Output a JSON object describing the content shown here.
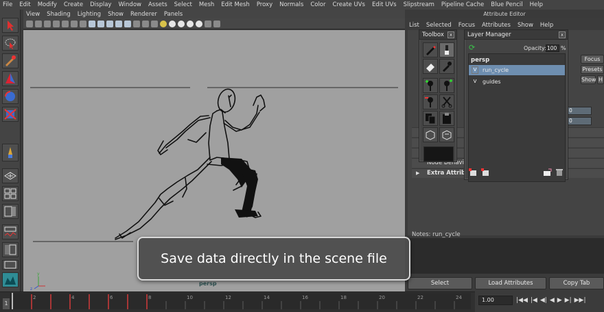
{
  "menubar": [
    "File",
    "Edit",
    "Modify",
    "Create",
    "Display",
    "Window",
    "Assets",
    "Select",
    "Mesh",
    "Edit Mesh",
    "Proxy",
    "Normals",
    "Color",
    "Create UVs",
    "Edit UVs",
    "Slipstream",
    "Pipeline Cache",
    "Blue Pencil",
    "Help"
  ],
  "viewport": {
    "menu": [
      "View",
      "Shading",
      "Lighting",
      "Show",
      "Renderer",
      "Panels"
    ],
    "camera": "persp"
  },
  "attribute_editor": {
    "title": "Attribute Editor",
    "menu": [
      "List",
      "Selected",
      "Focus",
      "Attributes",
      "Show",
      "Help"
    ],
    "focus_button": "Focus",
    "presets_button": "Presets",
    "show_button": "Show",
    "hide_button": "H",
    "field_1": "0",
    "field_2": "0",
    "section_node_behavior": "Node Behavior",
    "section_extra": "Extra Attributes",
    "notes_label": "Notes: run_cycle",
    "select_button": "Select",
    "load_button": "Load Attributes",
    "copy_button": "Copy Tab"
  },
  "toolbox": {
    "title": "Toolbox",
    "close": "x"
  },
  "layer_manager": {
    "title": "Layer Manager",
    "close": "x",
    "opacity_label": "Opacity:",
    "opacity_value": "100",
    "opacity_unit": "%",
    "header": "persp",
    "layers": [
      {
        "v": "V",
        "name": "run_cycle",
        "selected": true
      },
      {
        "v": "V",
        "name": "guides",
        "selected": false
      }
    ]
  },
  "timeline": {
    "start_frame": "1",
    "ticks": [
      "2",
      "4",
      "6",
      "8",
      "10",
      "12",
      "14",
      "16",
      "18",
      "20",
      "22",
      "24"
    ],
    "keyframes": [
      2,
      3,
      4,
      5,
      6,
      7,
      8
    ],
    "current_time": "1.00",
    "transport": [
      "|◀◀",
      "|◀",
      "◀|",
      "◀",
      "▶",
      "▶|",
      "▶▶|"
    ]
  },
  "caption": "Save data directly in the scene file"
}
